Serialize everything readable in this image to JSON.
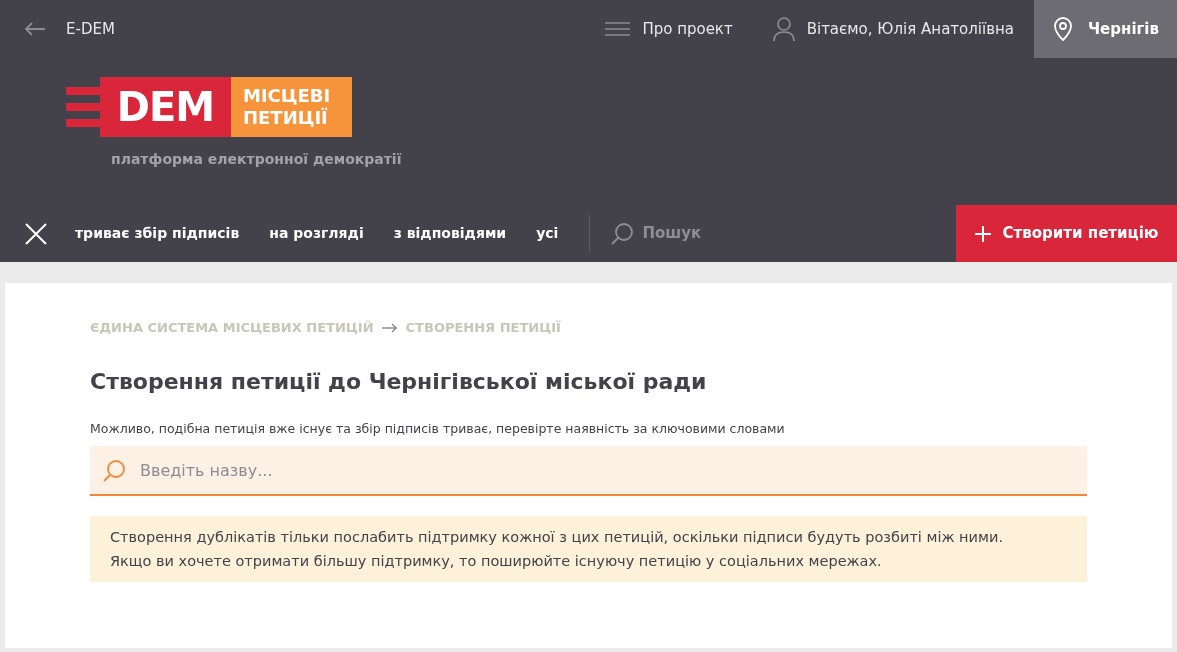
{
  "top_bar": {
    "back_label": "E-DEM",
    "about": "Про проект",
    "greeting": "Вітаємо, Юлія Анатоліївна",
    "city": "Чернігів"
  },
  "logo": {
    "mark": "DEM",
    "title_line1": "МІСЦЕВІ",
    "title_line2": "ПЕТИЦІЇ",
    "tagline": "платформа електронної демократії"
  },
  "nav": {
    "tabs": [
      "триває збір підписів",
      "на розгляді",
      "з відповідями",
      "усі"
    ],
    "search": "Пошук",
    "create_button": "Створити петицію"
  },
  "breadcrumbs": [
    "ЄДИНА СИСТЕМА МІСЦЕВИХ ПЕТИЦІЙ",
    "СТВОРЕННЯ ПЕТИЦІЇ"
  ],
  "heading": "Створення петиції до Чернігівської міської ради",
  "hint": "Можливо, подібна петиція вже існує та збір підписів триває, перевірте наявність за ключовими словами",
  "search_field": {
    "placeholder": "Введіть назву..."
  },
  "notice": [
    "Створення дублікатів тільки послабить підтримку кожної з цих петицій, оскільки підписи будуть розбиті між ними.",
    "Якщо ви хочете отримати більшу підтримку, то поширюйте існуючу петицію у соціальних мережах."
  ]
}
